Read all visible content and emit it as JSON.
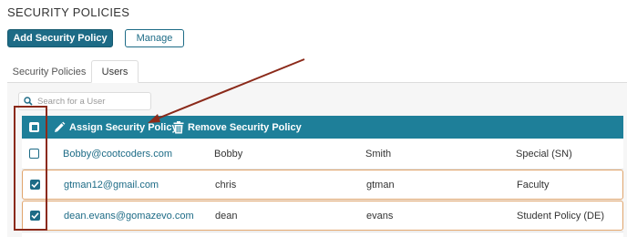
{
  "header": {
    "title": "SECURITY POLICIES"
  },
  "toolbar": {
    "add_label": "Add Security Policy",
    "manage_label": "Manage"
  },
  "tabs": [
    {
      "label": "Security Policies",
      "active": false
    },
    {
      "label": "Users",
      "active": true
    }
  ],
  "search": {
    "placeholder": "Search for a User",
    "value": ""
  },
  "table": {
    "select_all": "partial",
    "actions": {
      "assign_label": "Assign Security Policy",
      "remove_label": "Remove Security Policy"
    },
    "rows": [
      {
        "email": "Bobby@cootcoders.com",
        "first": "Bobby",
        "last": "Smith",
        "policy": "Special (SN)",
        "checked": false
      },
      {
        "email": "gtman12@gmail.com",
        "first": "chris",
        "last": "gtman",
        "policy": "Faculty",
        "checked": true
      },
      {
        "email": "dean.evans@gomazevo.com",
        "first": "dean",
        "last": "evans",
        "policy": "Student Policy (DE)",
        "checked": true
      }
    ]
  },
  "colors": {
    "primary": "#1d6b86",
    "table_header": "#1e7f99",
    "selected_row_border": "#e0a46b",
    "annotation": "#8b2a1a"
  },
  "icons": {
    "search": "search-icon",
    "assign": "pencil-icon",
    "remove": "trash-icon",
    "checked": "checkmark-icon"
  }
}
